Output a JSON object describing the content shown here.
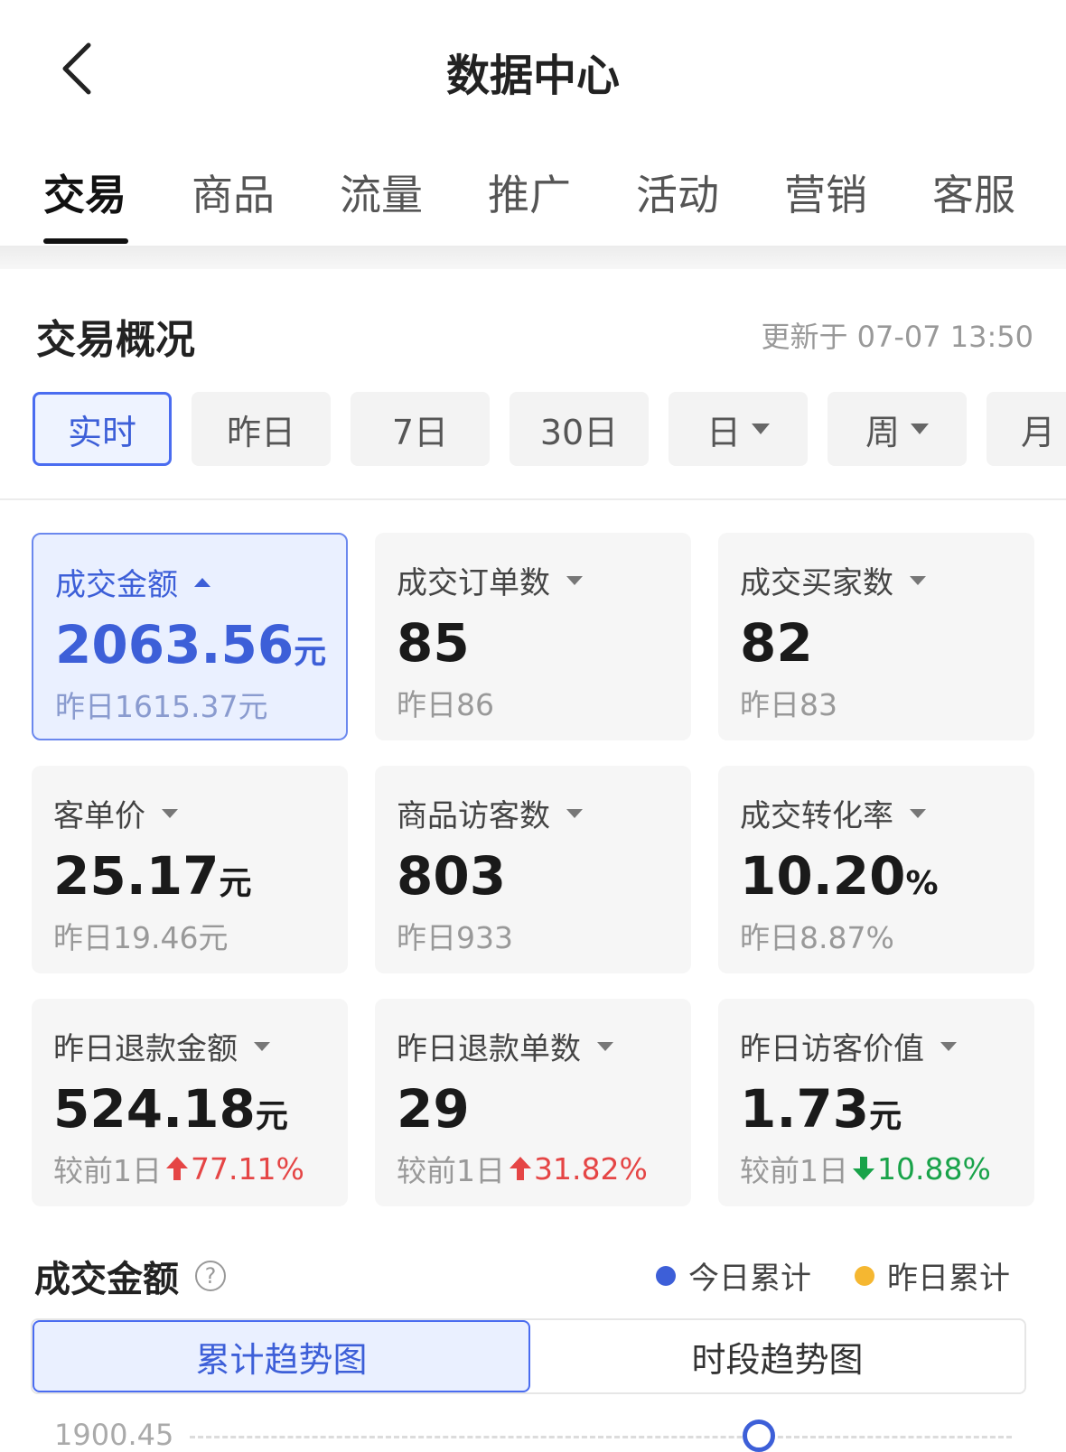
{
  "header": {
    "title": "数据中心"
  },
  "tabs": [
    {
      "label": "交易"
    },
    {
      "label": "商品"
    },
    {
      "label": "流量"
    },
    {
      "label": "推广"
    },
    {
      "label": "活动"
    },
    {
      "label": "营销"
    },
    {
      "label": "客服"
    }
  ],
  "overview": {
    "title": "交易概况",
    "updated": "更新于 07-07 13:50",
    "periods": [
      {
        "label": "实时"
      },
      {
        "label": "昨日"
      },
      {
        "label": "7日"
      },
      {
        "label": "30日"
      },
      {
        "label": "日"
      },
      {
        "label": "周"
      },
      {
        "label": "月"
      }
    ]
  },
  "metrics": [
    {
      "label": "成交金额",
      "value": "2063.56",
      "unit": "元",
      "sub": "昨日1615.37元"
    },
    {
      "label": "成交订单数",
      "value": "85",
      "unit": "",
      "sub": "昨日86"
    },
    {
      "label": "成交买家数",
      "value": "82",
      "unit": "",
      "sub": "昨日83"
    },
    {
      "label": "客单价",
      "value": "25.17",
      "unit": "元",
      "sub": "昨日19.46元"
    },
    {
      "label": "商品访客数",
      "value": "803",
      "unit": "",
      "sub": "昨日933"
    },
    {
      "label": "成交转化率",
      "value": "10.20",
      "unit": "%",
      "sub": "昨日8.87%"
    },
    {
      "label": "昨日退款金额",
      "value": "524.18",
      "unit": "元",
      "sub_prefix": "较前1日",
      "change": "77.11%"
    },
    {
      "label": "昨日退款单数",
      "value": "29",
      "unit": "",
      "sub_prefix": "较前1日",
      "change": "31.82%"
    },
    {
      "label": "昨日访客价值",
      "value": "1.73",
      "unit": "元",
      "sub_prefix": "较前1日",
      "change": "10.88%"
    }
  ],
  "chart": {
    "title": "成交金额",
    "help": "?",
    "legend": [
      {
        "label": "今日累计",
        "color": "#3d5fd8"
      },
      {
        "label": "昨日累计",
        "color": "#f5b731"
      }
    ],
    "segments": [
      {
        "label": "累计趋势图"
      },
      {
        "label": "时段趋势图"
      }
    ],
    "y_top_tick": "1900.45"
  }
}
